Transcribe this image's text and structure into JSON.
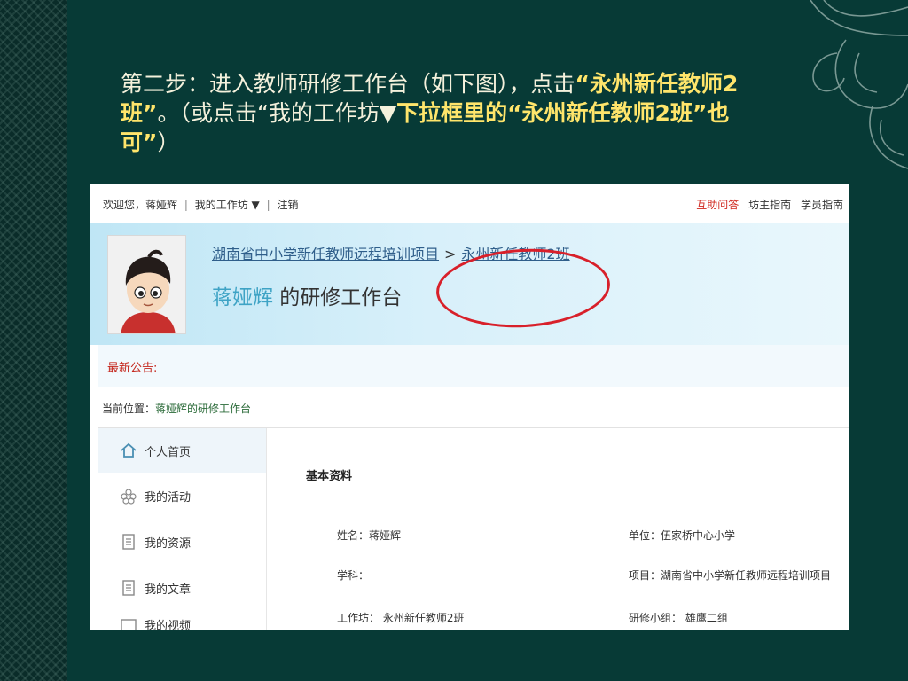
{
  "instruction": {
    "p1": "第二步：进入教师研修工作台（如下图），点击",
    "hl1": "“永州新任教师2班”",
    "p2": "。（或点击“我的工作坊▼",
    "hl2": "下拉框里的“永州新任教师2班”也可”",
    "p3": "）"
  },
  "topbar": {
    "welcome": "欢迎您，蒋娅辉",
    "sep": "|",
    "workshop": "我的工作坊 ▼",
    "logout": "注销",
    "help": "互助问答",
    "host_guide": "坊主指南",
    "student_guide": "学员指南"
  },
  "banner": {
    "crumb_project": "湖南省中小学新任教师远程培训项目",
    "crumb_sep": ">",
    "crumb_class": "永州新任教师2班",
    "user_name": "蒋娅辉",
    "title_suffix": " 的研修工作台"
  },
  "notice": {
    "label": "最新公告:"
  },
  "location": {
    "label": "当前位置：",
    "current": "蒋娅辉的研修工作台"
  },
  "sidenav": {
    "items": [
      {
        "label": "个人首页",
        "icon": "home-icon"
      },
      {
        "label": "我的活动",
        "icon": "flower-icon"
      },
      {
        "label": "我的资源",
        "icon": "document-icon"
      },
      {
        "label": "我的文章",
        "icon": "document-icon"
      },
      {
        "label": "我的视频",
        "icon": "video-icon"
      }
    ]
  },
  "profile": {
    "heading": "基本资料",
    "name": "姓名：蒋娅辉",
    "unit": "单位：伍家桥中心小学",
    "subject": "学科：",
    "project": "项目：湖南省中小学新任教师远程培训项目",
    "workshop": "工作坊：  永州新任教师2班",
    "group": "研修小组：  雄鹰二组"
  },
  "colors": {
    "slide_bg": "#073a36",
    "highlight": "#ffe56b",
    "annotation_red": "#d8202a",
    "link_blue": "#2f5e8a"
  }
}
